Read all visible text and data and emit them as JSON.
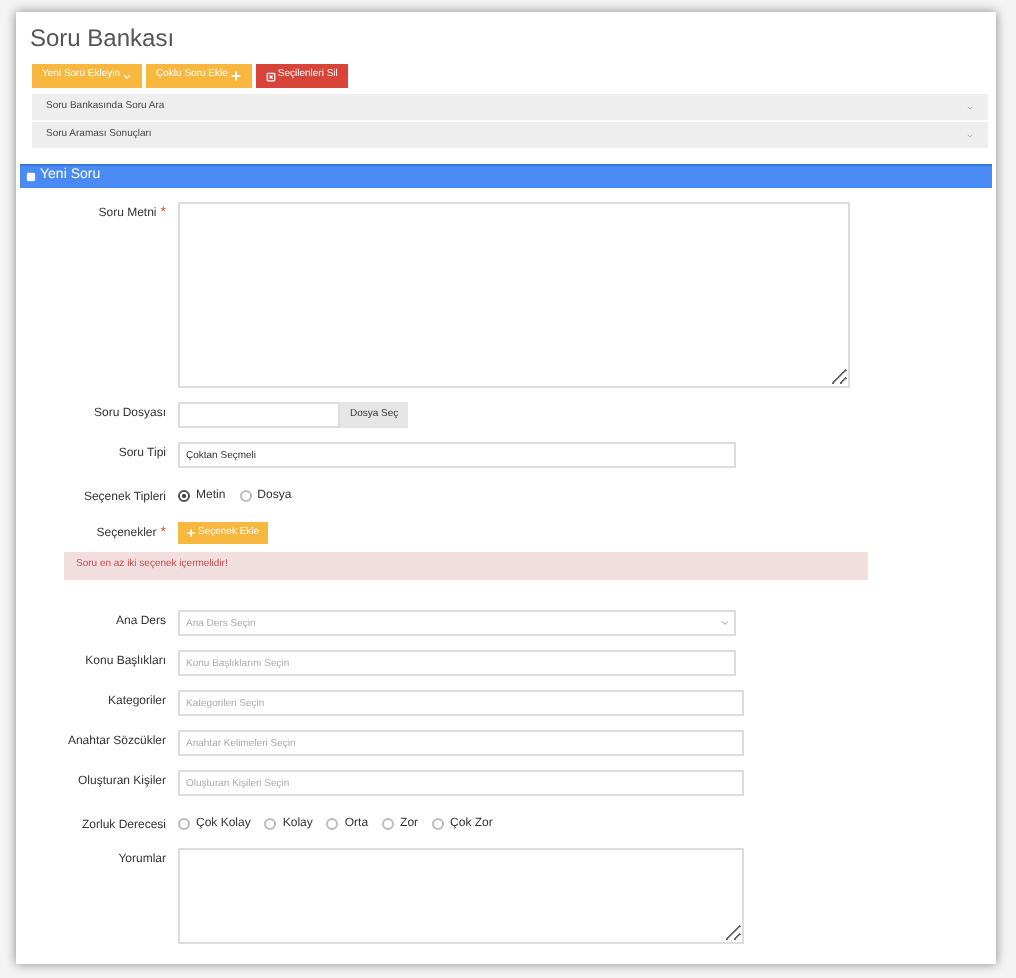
{
  "title": "Soru Bankası",
  "toolbar": [
    {
      "kind": "dropdown",
      "label": "Yeni Soru Ekleyin"
    },
    {
      "kind": "add",
      "label": "Çoklu Soru Ekle"
    },
    {
      "kind": "delete",
      "label": "Seçilenleri Sil"
    }
  ],
  "accordion": [
    {
      "label": "Soru Bankasında Soru Ara"
    },
    {
      "label": "Soru Araması Sonuçları"
    }
  ],
  "panel": {
    "title": "Yeni Soru"
  },
  "fields": [
    {
      "kind": "editor",
      "label": "Soru Metni",
      "mark": "*"
    },
    {
      "kind": "file",
      "label": "Soru Dosyası",
      "button": "Dosya Seç"
    },
    {
      "kind": "text",
      "label": "Soru Tipi",
      "value": "Çoktan Seçmeli"
    },
    {
      "kind": "radio",
      "label": "Seçenek Tipleri",
      "options": [
        {
          "label": "Metin",
          "selected": true
        },
        {
          "label": "Dosya",
          "selected": false
        }
      ]
    },
    {
      "kind": "button",
      "label": "Seçenekler",
      "mark": "*",
      "button": "Seçenek Ekle"
    },
    {
      "kind": "alert",
      "text": "Soru en az iki seçenek içermelidir!"
    },
    {
      "kind": "select",
      "label": "Ana Ders",
      "placeholder": "Ana Ders Seçin"
    },
    {
      "kind": "text",
      "label": "Konu Başlıkları",
      "placeholder": "Konu Başlıklarını Seçin"
    },
    {
      "kind": "text",
      "label": "Kategoriler",
      "placeholder": "Kategorileri Seçin"
    },
    {
      "kind": "text",
      "label": "Anahtar Sözcükler",
      "placeholder": "Anahtar Kelimeleri Seçin"
    },
    {
      "kind": "text",
      "label": "Oluşturan Kişiler",
      "placeholder": "Oluşturan Kişileri Seçin"
    },
    {
      "kind": "radio",
      "label": "Zorluk Derecesi",
      "options": [
        {
          "label": "Çok Kolay",
          "selected": false
        },
        {
          "label": "Kolay",
          "selected": false
        },
        {
          "label": "Orta",
          "selected": false
        },
        {
          "label": "Zor",
          "selected": false
        },
        {
          "label": "Çok Zor",
          "selected": false
        }
      ]
    },
    {
      "kind": "textarea",
      "label": "Yorumlar"
    }
  ]
}
